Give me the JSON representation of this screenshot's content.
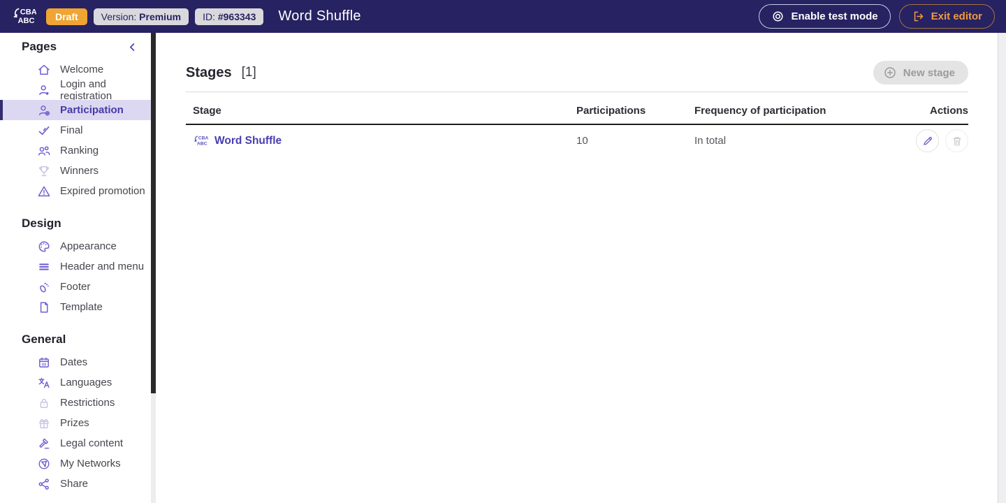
{
  "brand": {
    "top": "CBA",
    "bottom": "ABC"
  },
  "topbar": {
    "status_badge": "Draft",
    "version_label": "Version:",
    "version_value": "Premium",
    "id_label": "ID:",
    "id_value": "#963343",
    "title": "Word Shuffle",
    "test_mode_label": "Enable test mode",
    "exit_label": "Exit editor"
  },
  "sidebar": {
    "sections": [
      {
        "title": "Pages",
        "items": [
          {
            "label": "Welcome",
            "icon": "home-icon"
          },
          {
            "label": "Login and registration",
            "icon": "user-icon"
          },
          {
            "label": "Participation",
            "icon": "user-plus-icon",
            "active": true
          },
          {
            "label": "Final",
            "icon": "check-icon"
          },
          {
            "label": "Ranking",
            "icon": "ranking-icon"
          },
          {
            "label": "Winners",
            "icon": "trophy-icon",
            "disabled": true
          },
          {
            "label": "Expired promotion",
            "icon": "warning-icon"
          }
        ]
      },
      {
        "title": "Design",
        "items": [
          {
            "label": "Appearance",
            "icon": "palette-icon"
          },
          {
            "label": "Header and menu",
            "icon": "menu-icon"
          },
          {
            "label": "Footer",
            "icon": "footprint-icon"
          },
          {
            "label": "Template",
            "icon": "template-icon"
          }
        ]
      },
      {
        "title": "General",
        "items": [
          {
            "label": "Dates",
            "icon": "calendar-icon",
            "calendar_day": "03"
          },
          {
            "label": "Languages",
            "icon": "translate-icon"
          },
          {
            "label": "Restrictions",
            "icon": "lock-icon",
            "disabled": true
          },
          {
            "label": "Prizes",
            "icon": "gift-icon",
            "disabled": true
          },
          {
            "label": "Legal content",
            "icon": "gavel-icon"
          },
          {
            "label": "My Networks",
            "icon": "globe-network-icon"
          },
          {
            "label": "Share",
            "icon": "share-icon"
          }
        ]
      }
    ]
  },
  "main": {
    "heading": "Stages",
    "heading_count": "[1]",
    "new_stage_label": "New stage",
    "table": {
      "columns": [
        "Stage",
        "Participations",
        "Frequency of participation",
        "Actions"
      ],
      "rows": [
        {
          "stage": "Word Shuffle",
          "participations": "10",
          "frequency": "In total"
        }
      ]
    }
  },
  "colors": {
    "topbar_bg": "#272261",
    "accent_purple": "#6e60d2",
    "active_item_bg": "#dcd8f1",
    "active_item_text": "#453aa6",
    "draft_badge": "#f0a432",
    "exit_orange": "#ef9b41"
  }
}
